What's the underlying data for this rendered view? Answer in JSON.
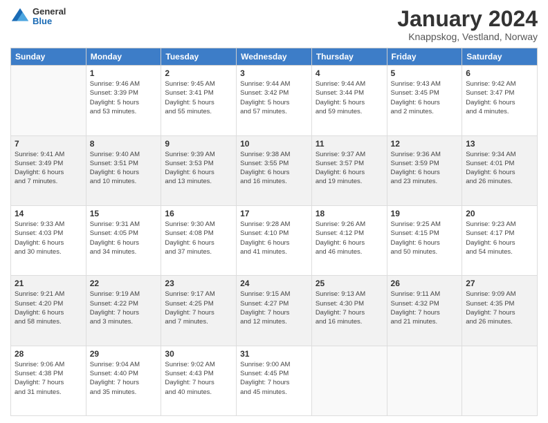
{
  "logo": {
    "general": "General",
    "blue": "Blue"
  },
  "title": "January 2024",
  "location": "Knappskog, Vestland, Norway",
  "days_of_week": [
    "Sunday",
    "Monday",
    "Tuesday",
    "Wednesday",
    "Thursday",
    "Friday",
    "Saturday"
  ],
  "weeks": [
    [
      {
        "day": "",
        "info": ""
      },
      {
        "day": "1",
        "info": "Sunrise: 9:46 AM\nSunset: 3:39 PM\nDaylight: 5 hours\nand 53 minutes."
      },
      {
        "day": "2",
        "info": "Sunrise: 9:45 AM\nSunset: 3:41 PM\nDaylight: 5 hours\nand 55 minutes."
      },
      {
        "day": "3",
        "info": "Sunrise: 9:44 AM\nSunset: 3:42 PM\nDaylight: 5 hours\nand 57 minutes."
      },
      {
        "day": "4",
        "info": "Sunrise: 9:44 AM\nSunset: 3:44 PM\nDaylight: 5 hours\nand 59 minutes."
      },
      {
        "day": "5",
        "info": "Sunrise: 9:43 AM\nSunset: 3:45 PM\nDaylight: 6 hours\nand 2 minutes."
      },
      {
        "day": "6",
        "info": "Sunrise: 9:42 AM\nSunset: 3:47 PM\nDaylight: 6 hours\nand 4 minutes."
      }
    ],
    [
      {
        "day": "7",
        "info": "Sunrise: 9:41 AM\nSunset: 3:49 PM\nDaylight: 6 hours\nand 7 minutes."
      },
      {
        "day": "8",
        "info": "Sunrise: 9:40 AM\nSunset: 3:51 PM\nDaylight: 6 hours\nand 10 minutes."
      },
      {
        "day": "9",
        "info": "Sunrise: 9:39 AM\nSunset: 3:53 PM\nDaylight: 6 hours\nand 13 minutes."
      },
      {
        "day": "10",
        "info": "Sunrise: 9:38 AM\nSunset: 3:55 PM\nDaylight: 6 hours\nand 16 minutes."
      },
      {
        "day": "11",
        "info": "Sunrise: 9:37 AM\nSunset: 3:57 PM\nDaylight: 6 hours\nand 19 minutes."
      },
      {
        "day": "12",
        "info": "Sunrise: 9:36 AM\nSunset: 3:59 PM\nDaylight: 6 hours\nand 23 minutes."
      },
      {
        "day": "13",
        "info": "Sunrise: 9:34 AM\nSunset: 4:01 PM\nDaylight: 6 hours\nand 26 minutes."
      }
    ],
    [
      {
        "day": "14",
        "info": "Sunrise: 9:33 AM\nSunset: 4:03 PM\nDaylight: 6 hours\nand 30 minutes."
      },
      {
        "day": "15",
        "info": "Sunrise: 9:31 AM\nSunset: 4:05 PM\nDaylight: 6 hours\nand 34 minutes."
      },
      {
        "day": "16",
        "info": "Sunrise: 9:30 AM\nSunset: 4:08 PM\nDaylight: 6 hours\nand 37 minutes."
      },
      {
        "day": "17",
        "info": "Sunrise: 9:28 AM\nSunset: 4:10 PM\nDaylight: 6 hours\nand 41 minutes."
      },
      {
        "day": "18",
        "info": "Sunrise: 9:26 AM\nSunset: 4:12 PM\nDaylight: 6 hours\nand 46 minutes."
      },
      {
        "day": "19",
        "info": "Sunrise: 9:25 AM\nSunset: 4:15 PM\nDaylight: 6 hours\nand 50 minutes."
      },
      {
        "day": "20",
        "info": "Sunrise: 9:23 AM\nSunset: 4:17 PM\nDaylight: 6 hours\nand 54 minutes."
      }
    ],
    [
      {
        "day": "21",
        "info": "Sunrise: 9:21 AM\nSunset: 4:20 PM\nDaylight: 6 hours\nand 58 minutes."
      },
      {
        "day": "22",
        "info": "Sunrise: 9:19 AM\nSunset: 4:22 PM\nDaylight: 7 hours\nand 3 minutes."
      },
      {
        "day": "23",
        "info": "Sunrise: 9:17 AM\nSunset: 4:25 PM\nDaylight: 7 hours\nand 7 minutes."
      },
      {
        "day": "24",
        "info": "Sunrise: 9:15 AM\nSunset: 4:27 PM\nDaylight: 7 hours\nand 12 minutes."
      },
      {
        "day": "25",
        "info": "Sunrise: 9:13 AM\nSunset: 4:30 PM\nDaylight: 7 hours\nand 16 minutes."
      },
      {
        "day": "26",
        "info": "Sunrise: 9:11 AM\nSunset: 4:32 PM\nDaylight: 7 hours\nand 21 minutes."
      },
      {
        "day": "27",
        "info": "Sunrise: 9:09 AM\nSunset: 4:35 PM\nDaylight: 7 hours\nand 26 minutes."
      }
    ],
    [
      {
        "day": "28",
        "info": "Sunrise: 9:06 AM\nSunset: 4:38 PM\nDaylight: 7 hours\nand 31 minutes."
      },
      {
        "day": "29",
        "info": "Sunrise: 9:04 AM\nSunset: 4:40 PM\nDaylight: 7 hours\nand 35 minutes."
      },
      {
        "day": "30",
        "info": "Sunrise: 9:02 AM\nSunset: 4:43 PM\nDaylight: 7 hours\nand 40 minutes."
      },
      {
        "day": "31",
        "info": "Sunrise: 9:00 AM\nSunset: 4:45 PM\nDaylight: 7 hours\nand 45 minutes."
      },
      {
        "day": "",
        "info": ""
      },
      {
        "day": "",
        "info": ""
      },
      {
        "day": "",
        "info": ""
      }
    ]
  ]
}
